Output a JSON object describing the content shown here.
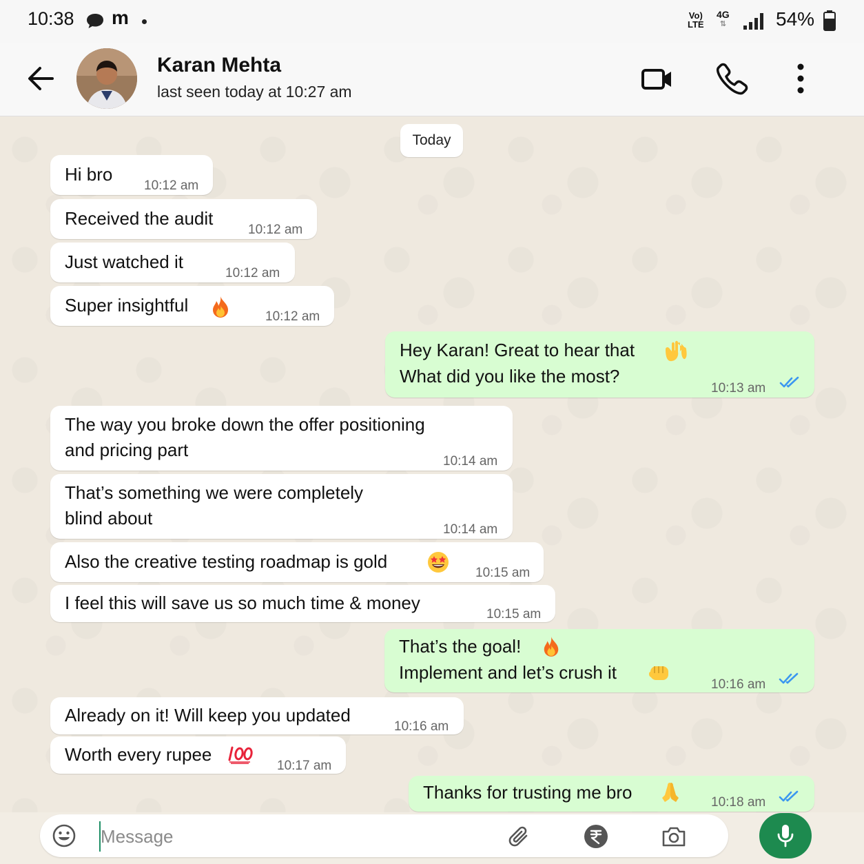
{
  "status_bar": {
    "time": "10:38",
    "carrier_icon": "m",
    "volte_top": "Vo)",
    "volte_bottom": "LTE",
    "network": "4G",
    "battery": "54%"
  },
  "header": {
    "contact_name": "Karan Mehta",
    "last_seen": "last seen today at 10:27 am",
    "icons": [
      "back-arrow-icon",
      "video-call-icon",
      "phone-icon",
      "more-vert-icon"
    ]
  },
  "chat": {
    "date_chip": "Today",
    "messages": [
      {
        "dir": "in",
        "text": "Hi bro",
        "time": "10:12 am"
      },
      {
        "dir": "in",
        "text": "Received the audit",
        "time": "10:12 am"
      },
      {
        "dir": "in",
        "text": "Just watched it",
        "time": "10:12 am"
      },
      {
        "dir": "in",
        "text": "Super insightful",
        "emoji": "fire",
        "time": "10:12 am"
      },
      {
        "dir": "out",
        "line1": "Hey Karan! Great to hear that",
        "line1_emoji": "raised-hands",
        "line2": "What did you like the most?",
        "time": "10:13 am",
        "read": true
      },
      {
        "dir": "in",
        "line1": "The way you broke down the offer positioning",
        "line2": "and pricing part",
        "time": "10:14 am"
      },
      {
        "dir": "in",
        "line1": "That’s something we were completely",
        "line2": "blind about",
        "time": "10:14 am"
      },
      {
        "dir": "in",
        "text": "Also the creative testing roadmap is gold",
        "emoji": "star-struck",
        "time": "10:15 am"
      },
      {
        "dir": "in",
        "text": "I feel this will save us so much time & money",
        "time": "10:15 am"
      },
      {
        "dir": "out",
        "line1": "That’s the goal!",
        "line1_emoji": "fire",
        "line2": "Implement and let’s crush it",
        "line2_emoji": "fist",
        "time": "10:16 am",
        "read": true
      },
      {
        "dir": "in",
        "text": "Already on it! Will keep you updated",
        "time": "10:16 am"
      },
      {
        "dir": "in",
        "text": "Worth every rupee",
        "emoji": "hundred",
        "time": "10:17 am"
      },
      {
        "dir": "out",
        "text": "Thanks for trusting me bro",
        "emoji": "folded-hands",
        "time": "10:18 am",
        "read": true
      }
    ]
  },
  "composer": {
    "placeholder": "Message",
    "icons": [
      "emoji-icon",
      "attach-icon",
      "rupee-payment-icon",
      "camera-icon",
      "mic-icon"
    ]
  },
  "colors": {
    "outgoing_bubble": "#d8fdd2",
    "incoming_bubble": "#ffffff",
    "read_ticks": "#3b97f0",
    "mic_button": "#1d8a4f",
    "chat_bg": "#efe9df"
  }
}
